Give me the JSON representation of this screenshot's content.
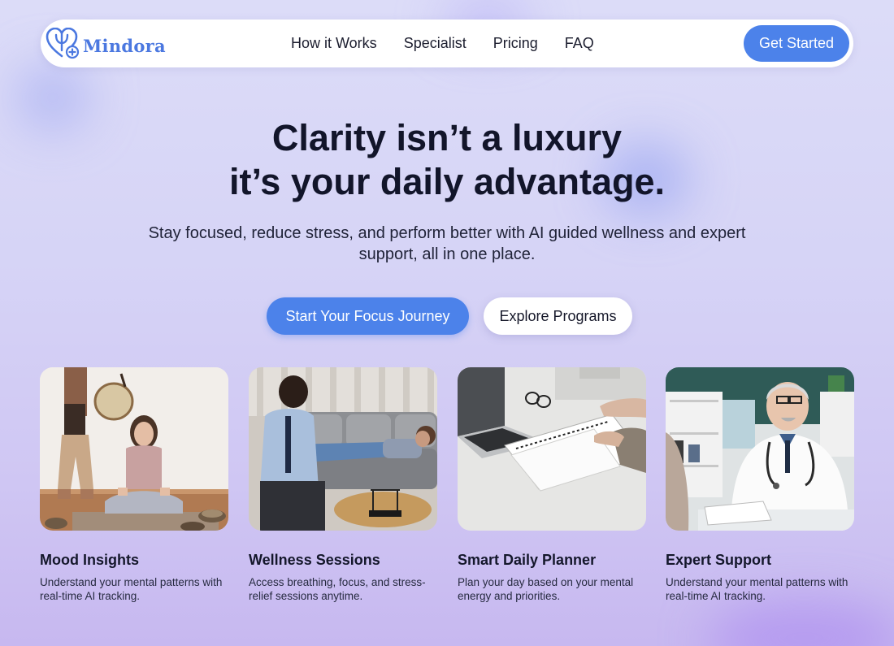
{
  "brand": {
    "name": "Mindora",
    "logo_icon": "heart-psi-plus-icon",
    "accent": "#4c82ea"
  },
  "nav": {
    "links": [
      "How it Works",
      "Specialist",
      "Pricing",
      "FAQ"
    ],
    "cta_label": "Get Started"
  },
  "hero": {
    "title_line1": "Clarity isn’t a luxury",
    "title_line2": "it’s your daily advantage.",
    "subtitle": "Stay focused, reduce stress, and perform better with AI guided wellness and expert support, all in one place.",
    "primary_cta": "Start Your Focus Journey",
    "secondary_cta": "Explore Programs"
  },
  "features": [
    {
      "title": "Mood Insights",
      "description": "Understand your mental patterns with real-time AI tracking.",
      "image": "meditation-photo"
    },
    {
      "title": "Wellness Sessions",
      "description": "Access breathing, focus, and stress-relief sessions anytime.",
      "image": "therapy-session-photo"
    },
    {
      "title": "Smart Daily Planner",
      "description": "Plan your day based on your mental energy and priorities.",
      "image": "laptop-planner-photo"
    },
    {
      "title": "Expert Support",
      "description": "Understand your mental patterns with real-time AI tracking.",
      "image": "doctor-consultation-photo"
    }
  ]
}
